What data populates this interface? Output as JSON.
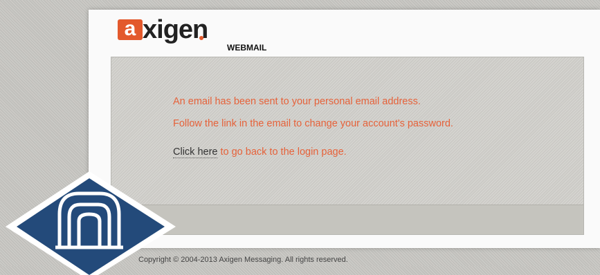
{
  "logo": {
    "letter": "a",
    "word": "xigen",
    "subtitle": "WEBMAIL"
  },
  "messages": {
    "line1": "An email has been sent to your personal email address.",
    "line2": "Follow the link in the email to change your account's password.",
    "link_label": "Click here",
    "line3_rest": " to go back to the login page."
  },
  "footer": {
    "copyright": "Copyright © 2004-2013 Axigen Messaging. All rights reserved."
  },
  "colors": {
    "accent": "#e3592c",
    "message": "#e6623a",
    "badge_blue": "#234a7a"
  }
}
